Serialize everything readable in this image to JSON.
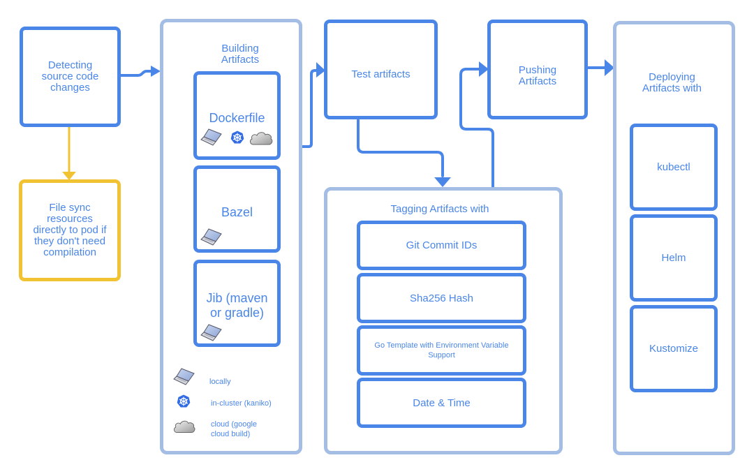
{
  "colors": {
    "primary": "#4a86e8",
    "container_border": "#a4bde5",
    "sync_border": "#f1c232"
  },
  "detect": {
    "label": "Detecting\nsource code\nchanges"
  },
  "file_sync": {
    "label": "File sync\nresources\ndirectly to pod if\nthey don't need\ncompilation"
  },
  "building": {
    "title": "Building\nArtifacts",
    "builders": [
      {
        "label": "Dockerfile",
        "icons": [
          "laptop-icon",
          "kubernetes-icon",
          "cloud-icon"
        ]
      },
      {
        "label": "Bazel",
        "icons": [
          "laptop-icon"
        ]
      },
      {
        "label": "Jib (maven\nor gradle)",
        "icons": [
          "laptop-icon"
        ]
      }
    ],
    "legend": [
      {
        "icon": "laptop-icon",
        "label": "locally"
      },
      {
        "icon": "kubernetes-icon",
        "label": "in-cluster (kaniko)"
      },
      {
        "icon": "cloud-icon",
        "label": "cloud (google\ncloud build)"
      }
    ]
  },
  "test": {
    "label": "Test artifacts"
  },
  "pushing": {
    "label": "Pushing\nArtifacts"
  },
  "tagging": {
    "title": "Tagging Artifacts with",
    "items": [
      "Git Commit IDs",
      "Sha256 Hash",
      "Go Template with Environment Variable\nSupport",
      "Date & Time"
    ]
  },
  "deploying": {
    "title": "Deploying\nArtifacts with",
    "items": [
      "kubectl",
      "Helm",
      "Kustomize"
    ]
  }
}
